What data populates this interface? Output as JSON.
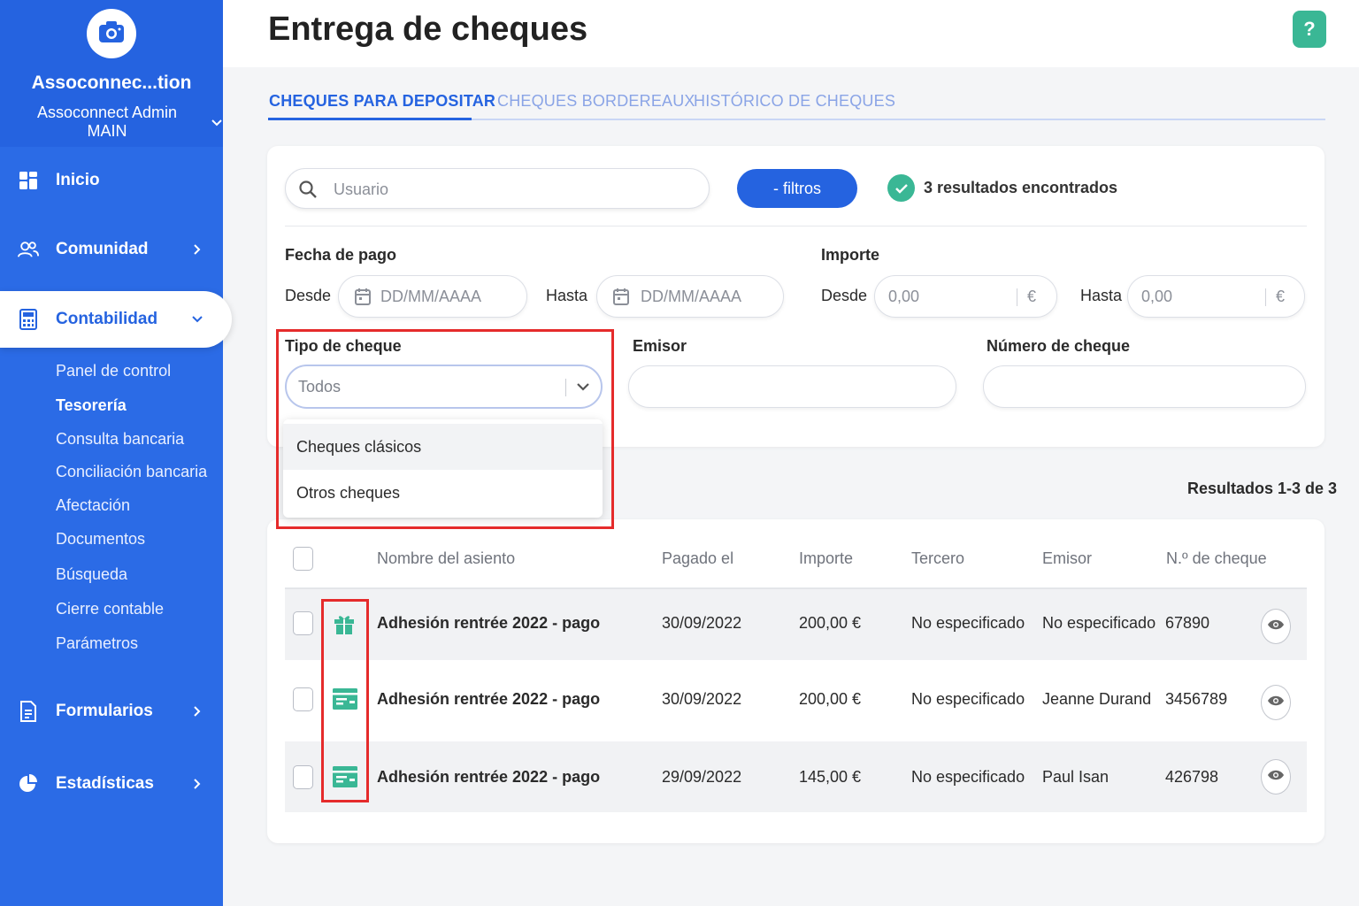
{
  "sidebar": {
    "org_name": "Assoconnec...tion",
    "org_sub": "Assoconnect Admin MAIN",
    "nav": {
      "inicio": "Inicio",
      "comunidad": "Comunidad",
      "contabilidad": "Contabilidad",
      "formularios": "Formularios",
      "estadisticas": "Estadísticas"
    },
    "sub_items": [
      "Panel de control",
      "Tesorería",
      "Consulta bancaria",
      "Conciliación bancaria",
      "Afectación",
      "Documentos",
      "Búsqueda",
      "Cierre contable",
      "Parámetros"
    ],
    "active_sub": "Tesorería"
  },
  "header": {
    "title": "Entrega de cheques",
    "help": "?"
  },
  "tabs": [
    "CHEQUES PARA DEPOSITAR",
    "CHEQUES BORDEREAUX",
    "HISTÓRICO DE CHEQUES"
  ],
  "filters": {
    "search_placeholder": "Usuario",
    "filter_button": "- filtros",
    "results_found": "3 resultados encontrados",
    "fecha_label": "Fecha de pago",
    "importe_label": "Importe",
    "desde": "Desde",
    "hasta": "Hasta",
    "date_placeholder": "DD/MM/AAAA",
    "amount_placeholder": "0,00",
    "currency": "€",
    "tipo_label": "Tipo de cheque",
    "tipo_value": "Todos",
    "tipo_options": [
      "Cheques clásicos",
      "Otros cheques"
    ],
    "emisor_label": "Emisor",
    "numero_label": "Número de cheque"
  },
  "results_count": "Resultados 1-3 de 3",
  "table": {
    "columns": [
      "Nombre del asiento",
      "Pagado el",
      "Importe",
      "Tercero",
      "Emisor",
      "N.º de cheque"
    ],
    "rows": [
      {
        "icon": "gift-icon",
        "name": "Adhesión rentrée 2022 - pago",
        "date": "30/09/2022",
        "amount": "200,00 €",
        "tercero": "No especificado",
        "emisor": "No especificado",
        "numero": "67890"
      },
      {
        "icon": "cheque-icon",
        "name": "Adhesión rentrée 2022 - pago",
        "date": "30/09/2022",
        "amount": "200,00 €",
        "tercero": "No especificado",
        "emisor": "Jeanne Durand",
        "numero": "3456789"
      },
      {
        "icon": "cheque-icon",
        "name": "Adhesión rentrée 2022 - pago",
        "date": "29/09/2022",
        "amount": "145,00 €",
        "tercero": "No especificado",
        "emisor": "Paul Isan",
        "numero": "426798"
      }
    ]
  },
  "colors": {
    "primary": "#2563e0",
    "sidebar": "#2b6be6",
    "accent_green": "#3ab795",
    "highlight_red": "#e52b2b"
  }
}
